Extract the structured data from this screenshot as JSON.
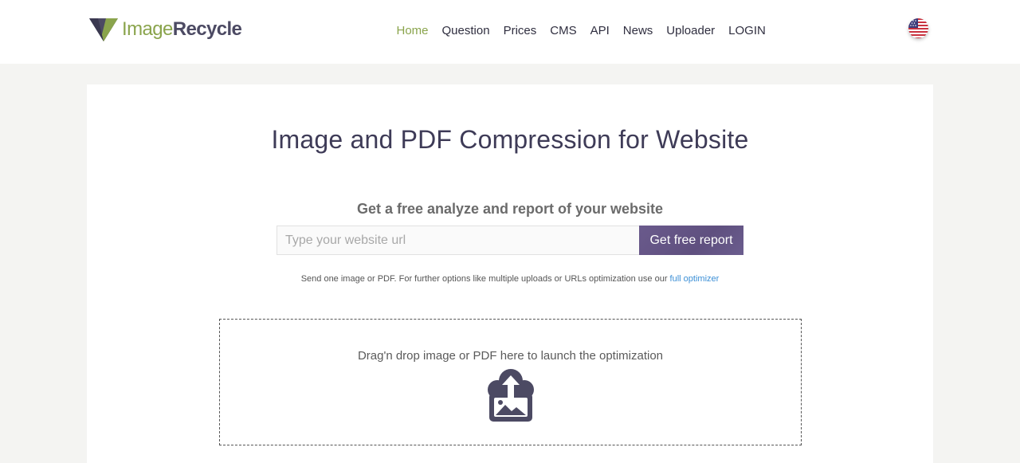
{
  "brand": {
    "logo_part1": "Image",
    "logo_part2": "Recycle",
    "primary_color": "#8aa44c",
    "secondary_color": "#4c4a63",
    "logo_icon": "triangle-logo-icon"
  },
  "nav": {
    "items": [
      {
        "label": "Home",
        "active": true
      },
      {
        "label": "Question",
        "active": false
      },
      {
        "label": "Prices",
        "active": false
      },
      {
        "label": "CMS",
        "active": false
      },
      {
        "label": "API",
        "active": false
      },
      {
        "label": "News",
        "active": false
      },
      {
        "label": "Uploader",
        "active": false
      },
      {
        "label": "LOGIN",
        "active": false
      }
    ],
    "language_icon": "us-flag-icon"
  },
  "main": {
    "title": "Image and PDF Compression for Website",
    "analyze_heading": "Get a free analyze and report of your website",
    "url_input_value": "",
    "url_input_placeholder": "Type your website url",
    "report_button_label": "Get free report",
    "report_button_color": "#66578a",
    "note_text": "Send one image or PDF. For further options like multiple uploads or URLs optimization use our ",
    "note_link": "full optimizer",
    "link_color": "#3b8fd6"
  },
  "dropzone": {
    "text": "Drag'n drop image or PDF here to launch the optimization",
    "icon": "cloud-upload-image-icon"
  }
}
